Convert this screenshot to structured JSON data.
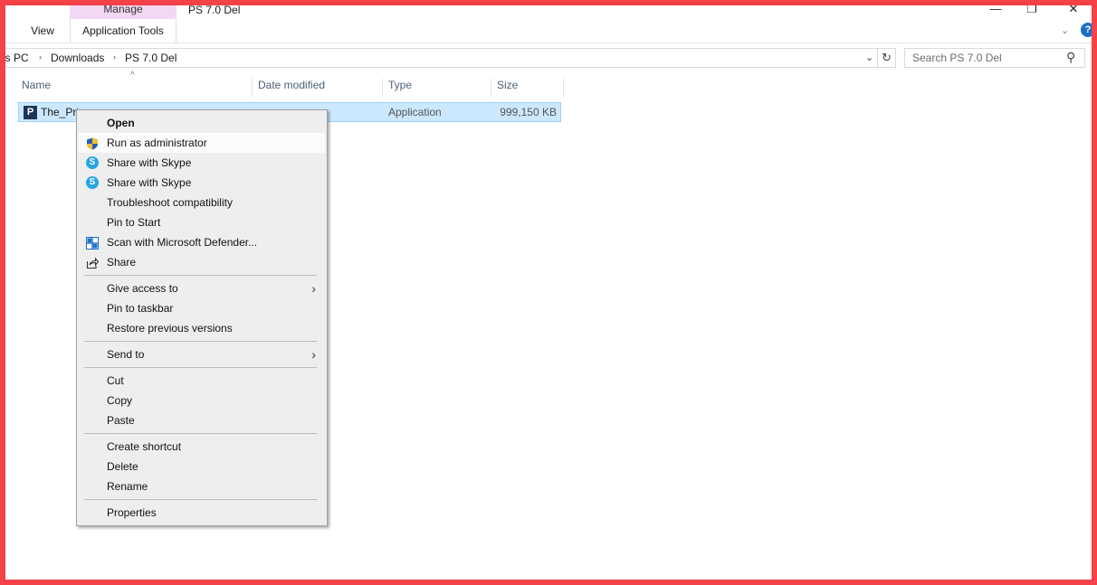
{
  "window": {
    "title": "PS 7.0 Del",
    "minimize": "—",
    "maximize": "❐",
    "close": "✕"
  },
  "ribbon": {
    "manage_label": "Manage",
    "app_tools_label": "Application Tools",
    "view_label": "View",
    "expand": "⌄",
    "help": "?"
  },
  "address": {
    "crumbs": [
      "is PC",
      "Downloads",
      "PS 7.0 Del"
    ],
    "separator": "›",
    "dropdown": "⌄",
    "refresh": "↻"
  },
  "search": {
    "placeholder": "Search PS 7.0 Del",
    "icon": "search-icon",
    "glyph": "⚲"
  },
  "columns": {
    "sort_arrow": "^",
    "name": "Name",
    "date": "Date modified",
    "type": "Type",
    "size": "Size"
  },
  "file": {
    "icon_letter": "P",
    "name": "The_Pri",
    "type": "Application",
    "size": "999,150 KB"
  },
  "menu": {
    "open": "Open",
    "run_admin": "Run as administrator",
    "share_skype_1": "Share with Skype",
    "share_skype_2": "Share with Skype",
    "troubleshoot": "Troubleshoot compatibility",
    "pin_start": "Pin to Start",
    "scan_defender": "Scan with Microsoft Defender...",
    "share": "Share",
    "give_access": "Give access to",
    "pin_taskbar": "Pin to taskbar",
    "restore": "Restore previous versions",
    "send_to": "Send to",
    "cut": "Cut",
    "copy": "Copy",
    "paste": "Paste",
    "create_shortcut": "Create shortcut",
    "delete": "Delete",
    "rename": "Rename",
    "properties": "Properties",
    "submenu_arrow": "›",
    "skype_letter": "S"
  },
  "colors": {
    "frame": "#f44248",
    "selection": "#cce8ff",
    "manage_tab": "#f2d8f2",
    "skype": "#27a6e3"
  }
}
